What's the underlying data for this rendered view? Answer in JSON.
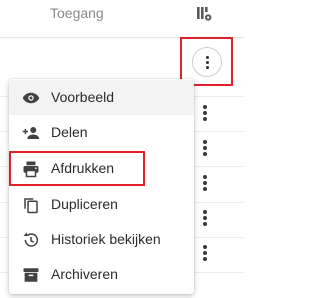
{
  "header": {
    "column_label": "Toegang",
    "columns_icon": "column-settings-icon"
  },
  "row_actions": {
    "icon": "more-vert-icon"
  },
  "menu": {
    "items": [
      {
        "label": "Voorbeeld",
        "icon": "eye-icon"
      },
      {
        "label": "Delen",
        "icon": "person-add-icon"
      },
      {
        "label": "Afdrukken",
        "icon": "printer-icon"
      },
      {
        "label": "Dupliceren",
        "icon": "copy-icon"
      },
      {
        "label": "Historiek bekijken",
        "icon": "history-icon"
      },
      {
        "label": "Archiveren",
        "icon": "archive-icon"
      }
    ]
  },
  "colors": {
    "highlight_border": "#e0202a",
    "hover_background": "#f3f3f3",
    "icon_color": "#424242",
    "header_text": "#8a8a8a"
  }
}
